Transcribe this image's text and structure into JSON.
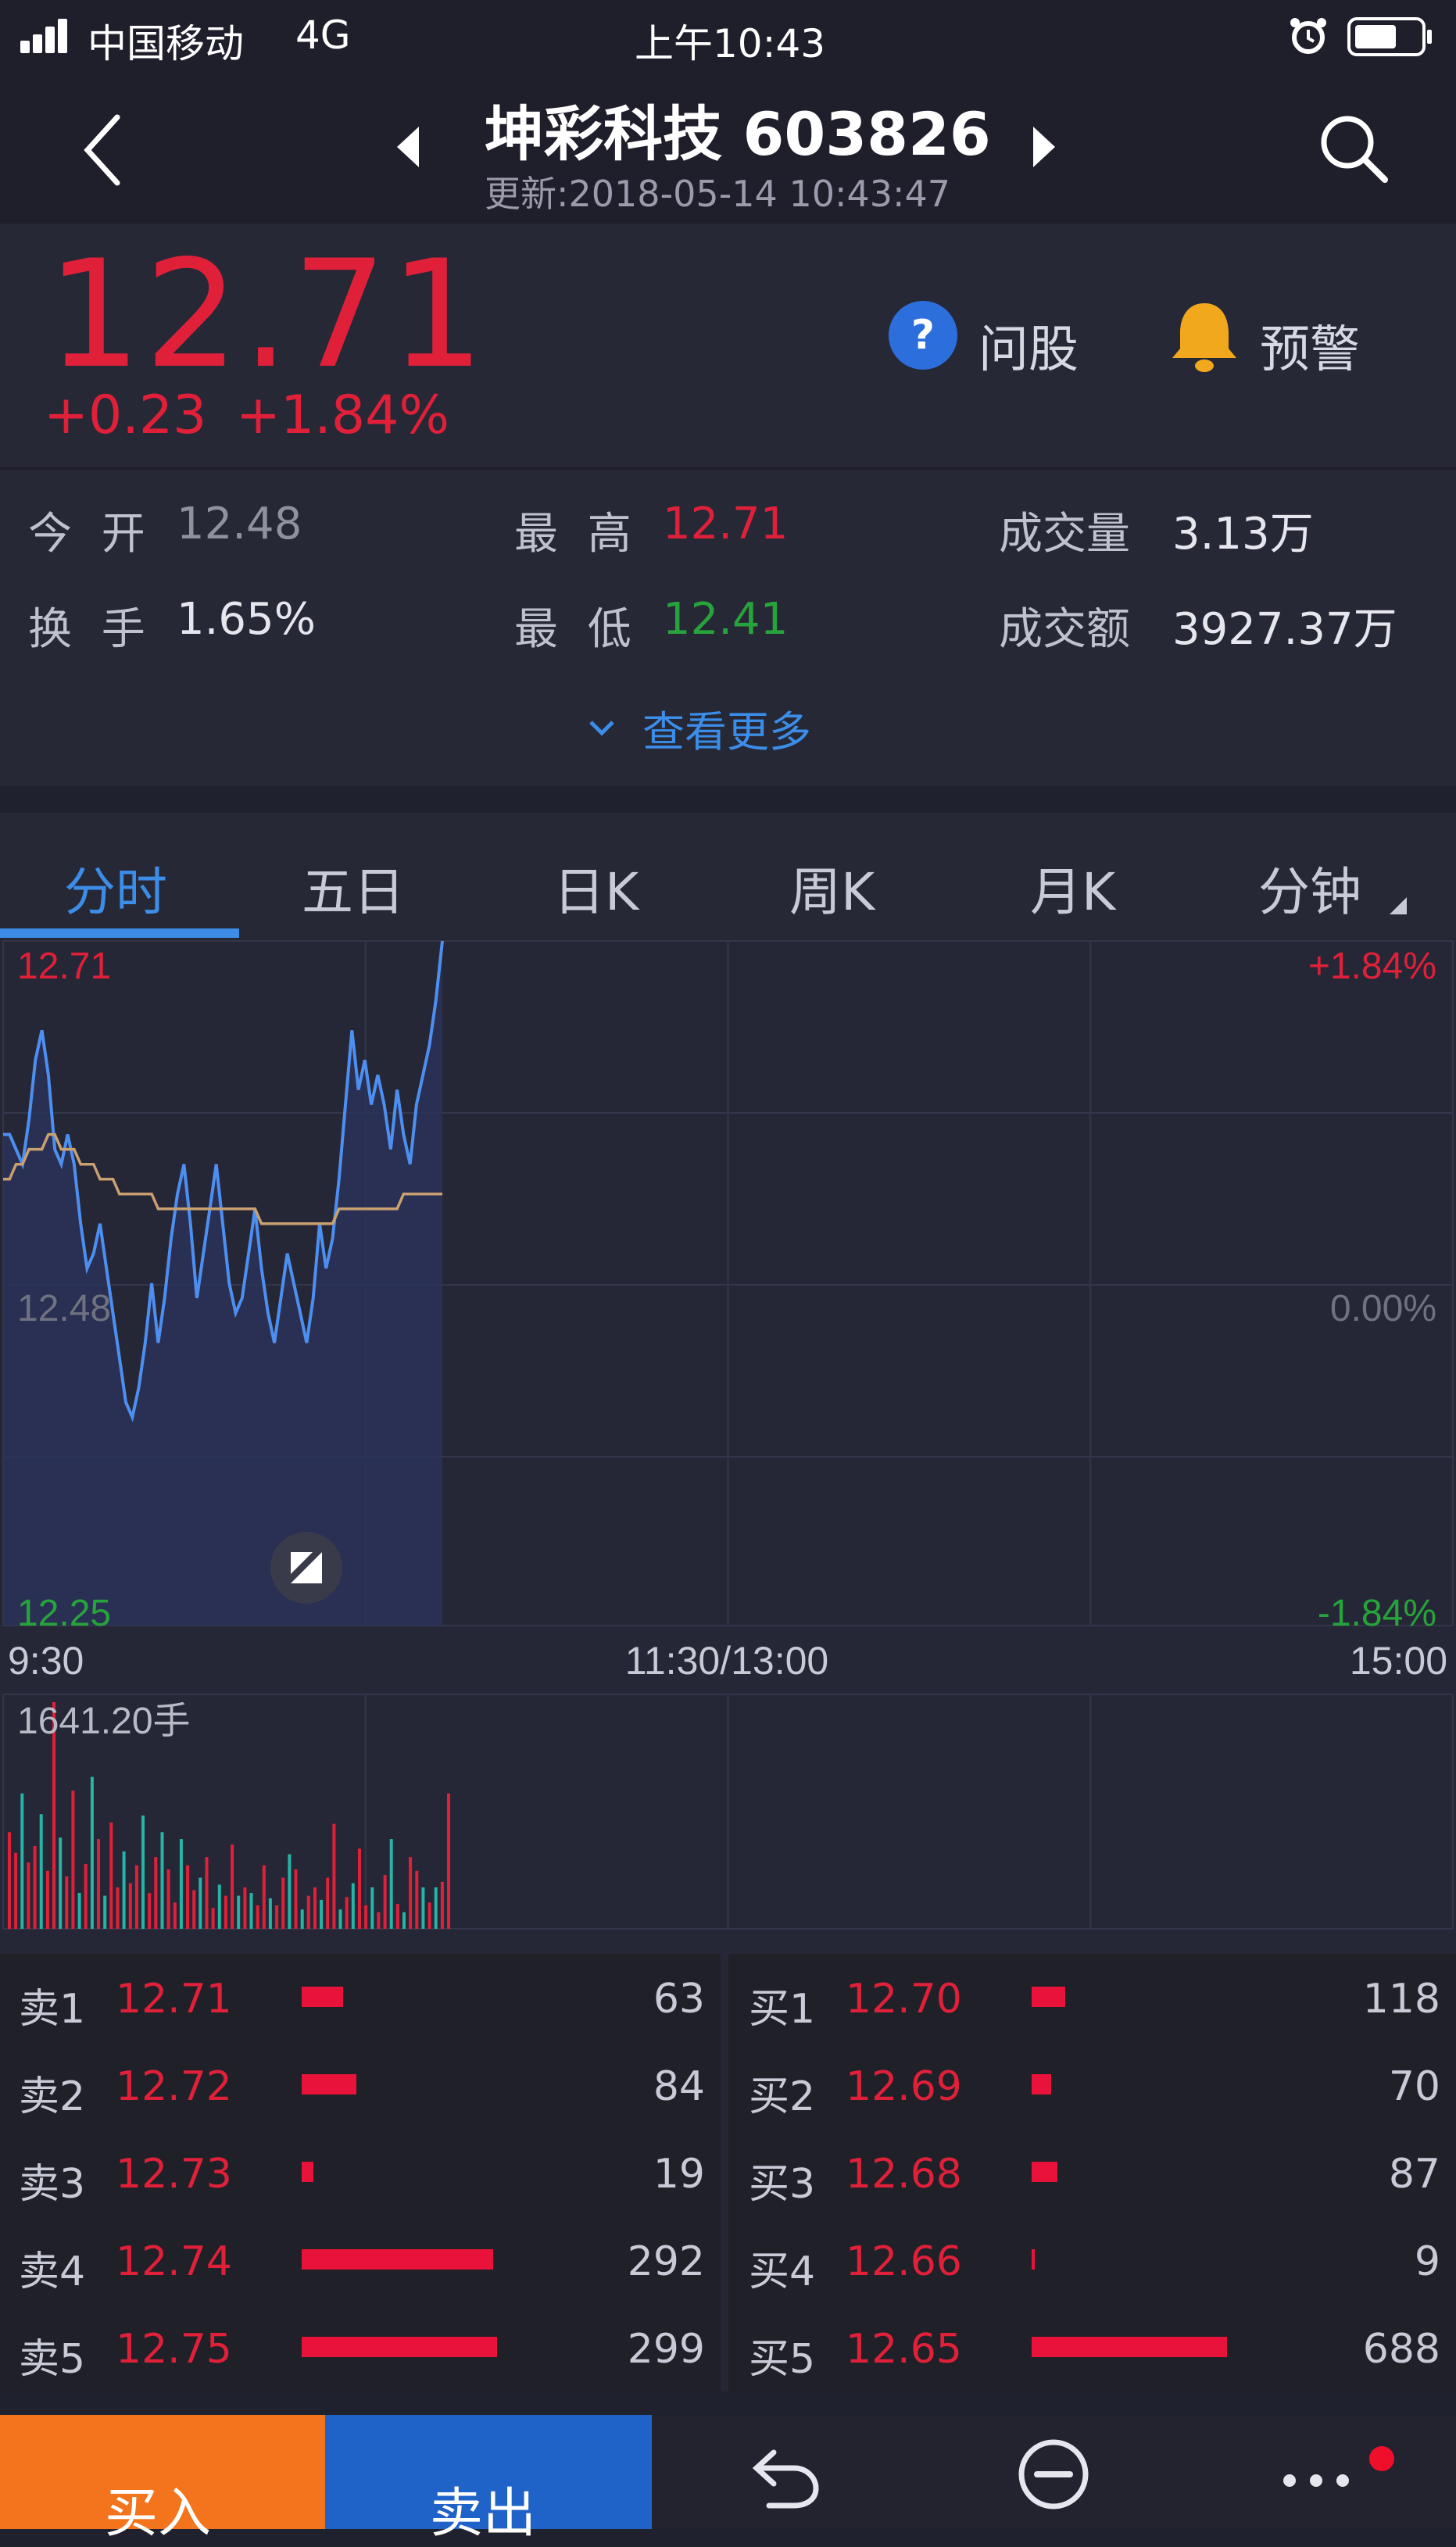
{
  "status": {
    "carrier": "中国移动",
    "network": "4G",
    "time": "上午10:43"
  },
  "header": {
    "title": "坤彩科技 603826",
    "updated": "更新:2018-05-14 10:43:47"
  },
  "quote": {
    "price": "12.71",
    "change": "+0.23",
    "change_pct": "+1.84%",
    "ask_stock_label": "问股",
    "alert_label": "预警",
    "stats": {
      "open_label": "今 开",
      "open": "12.48",
      "high_label": "最 高",
      "high": "12.71",
      "volume_label": "成交量",
      "volume": "3.13万",
      "turnover_label": "换 手",
      "turnover": "1.65%",
      "low_label": "最 低",
      "low": "12.41",
      "amount_label": "成交额",
      "amount": "3927.37万"
    },
    "more_label": "查看更多"
  },
  "tabs": [
    {
      "label": "分时",
      "active": true
    },
    {
      "label": "五日",
      "active": false
    },
    {
      "label": "日K",
      "active": false
    },
    {
      "label": "周K",
      "active": false
    },
    {
      "label": "月K",
      "active": false
    },
    {
      "label": "分钟",
      "active": false
    }
  ],
  "colors": {
    "up": "#e02039",
    "down": "#27a33b",
    "accent": "#3b8de8",
    "price_line": "#4d8ff0",
    "avg_line": "#c9a070",
    "vol_down": "#25b4a6",
    "buy_button": "#f3741c",
    "sell_button": "#1f63c9"
  },
  "chart_data": {
    "type": "line",
    "y_labels": {
      "top": "12.71",
      "mid": "12.48",
      "bottom": "12.25"
    },
    "pct_labels": {
      "top": "+1.84%",
      "mid": "0.00%",
      "bottom": "-1.84%"
    },
    "x_labels": [
      "9:30",
      "11:30/13:00",
      "15:00"
    ],
    "ylim": [
      12.25,
      12.71
    ],
    "base_price": 12.48,
    "session_minutes": 240,
    "series": [
      {
        "values": [
          12.58,
          12.58,
          12.57,
          12.56,
          12.59,
          12.63,
          12.65,
          12.62,
          12.57,
          12.56,
          12.58,
          12.56,
          12.52,
          12.49,
          12.5,
          12.52,
          12.49,
          12.46,
          12.43,
          12.4,
          12.39,
          12.41,
          12.44,
          12.48,
          12.44,
          12.47,
          12.51,
          12.54,
          12.56,
          12.52,
          12.47,
          12.5,
          12.53,
          12.56,
          12.52,
          12.48,
          12.46,
          12.47,
          12.5,
          12.53,
          12.49,
          12.46,
          12.44,
          12.47,
          12.5,
          12.48,
          12.46,
          12.44,
          12.47,
          12.52,
          12.49,
          12.51,
          12.55,
          12.6,
          12.65,
          12.61,
          12.63,
          12.6,
          12.62,
          12.6,
          12.57,
          12.61,
          12.58,
          12.56,
          12.6,
          12.62,
          12.64,
          12.67,
          12.71
        ]
      },
      {
        "values": [
          12.55,
          12.55,
          12.56,
          12.56,
          12.57,
          12.57,
          12.57,
          12.58,
          12.58,
          12.57,
          12.57,
          12.57,
          12.56,
          12.56,
          12.56,
          12.55,
          12.55,
          12.55,
          12.54,
          12.54,
          12.54,
          12.54,
          12.54,
          12.54,
          12.53,
          12.53,
          12.53,
          12.53,
          12.53,
          12.53,
          12.53,
          12.53,
          12.53,
          12.53,
          12.53,
          12.53,
          12.53,
          12.53,
          12.53,
          12.53,
          12.52,
          12.52,
          12.52,
          12.52,
          12.52,
          12.52,
          12.52,
          12.52,
          12.52,
          12.52,
          12.52,
          12.52,
          12.53,
          12.53,
          12.53,
          12.53,
          12.53,
          12.53,
          12.53,
          12.53,
          12.53,
          12.53,
          12.54,
          12.54,
          12.54,
          12.54,
          12.54,
          12.54,
          12.54
        ]
      }
    ],
    "volume_label": "1641.20手",
    "volume": {
      "max": 1641.2,
      "values": [
        700,
        550,
        980,
        480,
        600,
        830,
        420,
        1641,
        660,
        380,
        1000,
        260,
        470,
        1100,
        650,
        240,
        770,
        300,
        560,
        330,
        460,
        820,
        260,
        520,
        700,
        430,
        190,
        650,
        460,
        280,
        370,
        520,
        150,
        320,
        240,
        610,
        240,
        300,
        260,
        170,
        460,
        220,
        170,
        370,
        540,
        430,
        140,
        240,
        300,
        210,
        370,
        760,
        140,
        230,
        330,
        580,
        170,
        300,
        120,
        390,
        650,
        180,
        120,
        520,
        420,
        300,
        190,
        300,
        340,
        980
      ],
      "up": [
        1,
        1,
        0,
        1,
        1,
        0,
        1,
        1,
        0,
        1,
        1,
        0,
        1,
        0,
        1,
        0,
        1,
        1,
        0,
        1,
        1,
        0,
        1,
        1,
        0,
        1,
        1,
        0,
        1,
        1,
        0,
        1,
        1,
        0,
        1,
        1,
        0,
        1,
        0,
        1,
        1,
        0,
        1,
        1,
        0,
        1,
        0,
        1,
        1,
        0,
        1,
        1,
        0,
        1,
        0,
        1,
        1,
        0,
        1,
        1,
        0,
        1,
        0,
        1,
        1,
        0,
        1,
        0,
        1,
        1
      ]
    }
  },
  "orderbook": {
    "sells": [
      {
        "label": "卖1",
        "price": "12.71",
        "qty": "63",
        "bar": 0.21
      },
      {
        "label": "卖2",
        "price": "12.72",
        "qty": "84",
        "bar": 0.28
      },
      {
        "label": "卖3",
        "price": "12.73",
        "qty": "19",
        "bar": 0.06
      },
      {
        "label": "卖4",
        "price": "12.74",
        "qty": "292",
        "bar": 0.98
      },
      {
        "label": "卖5",
        "price": "12.75",
        "qty": "299",
        "bar": 1.0
      }
    ],
    "buys": [
      {
        "label": "买1",
        "price": "12.70",
        "qty": "118",
        "bar": 0.17
      },
      {
        "label": "买2",
        "price": "12.69",
        "qty": "70",
        "bar": 0.1
      },
      {
        "label": "买3",
        "price": "12.68",
        "qty": "87",
        "bar": 0.13
      },
      {
        "label": "买4",
        "price": "12.66",
        "qty": "9",
        "bar": 0.013
      },
      {
        "label": "买5",
        "price": "12.65",
        "qty": "688",
        "bar": 1.0
      }
    ]
  },
  "bottom": {
    "buy_label": "买入",
    "sell_label": "卖出"
  }
}
